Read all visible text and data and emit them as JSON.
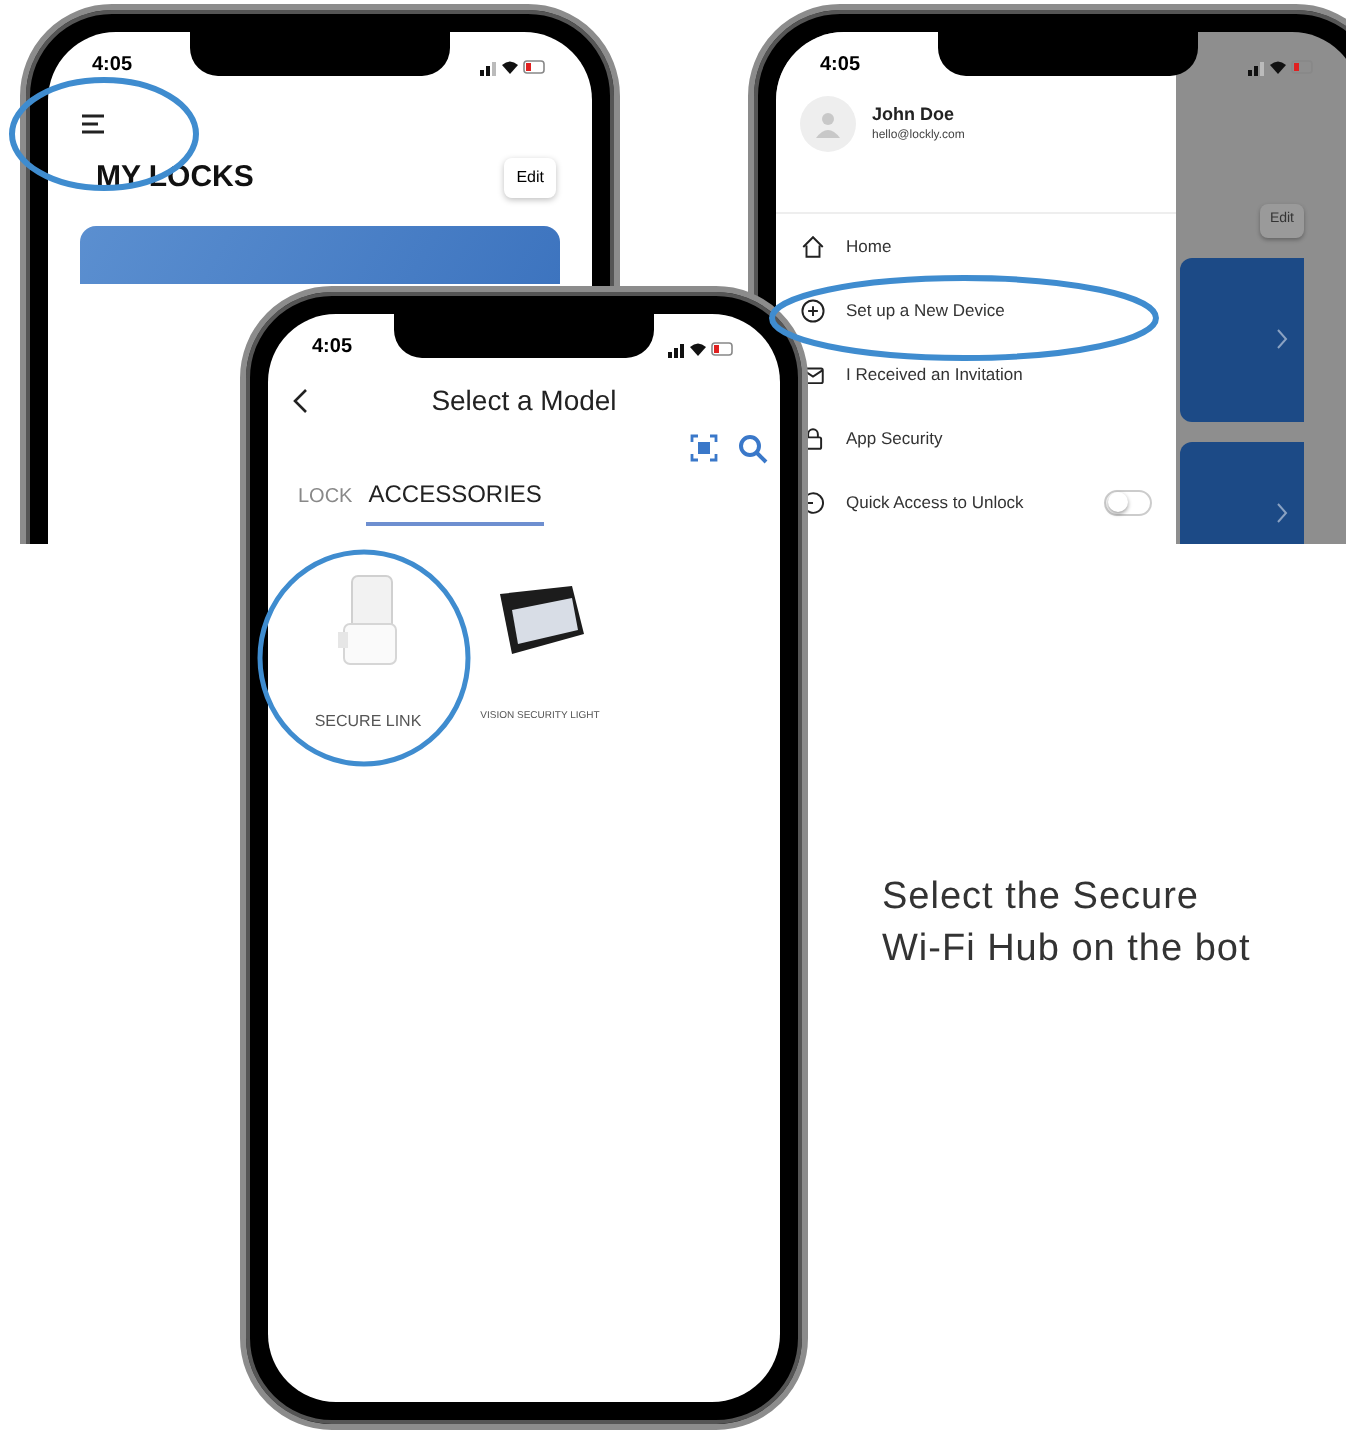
{
  "locks_screen": {
    "time": "4:05",
    "title": "MY LOCKS",
    "edit": "Edit"
  },
  "menu_screen": {
    "time": "4:05",
    "user_name": "John Doe",
    "email": "hello@lockly.com",
    "edit": "Edit",
    "items": [
      {
        "kind": "home",
        "label": "Home"
      },
      {
        "kind": "add",
        "label": "Set up a New Device"
      },
      {
        "kind": "invite",
        "label": "I Received an Invitation"
      },
      {
        "kind": "lock",
        "label": "App Security"
      },
      {
        "kind": "toggle",
        "label": "Quick Access to Unlock",
        "on": false
      }
    ]
  },
  "model_screen": {
    "time": "4:05",
    "title": "Select a Model",
    "tabs": [
      {
        "label": "LOCK",
        "selected": false
      },
      {
        "label": "ACCESSORIES",
        "selected": true
      }
    ],
    "products": [
      {
        "kind": "hub",
        "name": "SECURE LINK"
      },
      {
        "kind": "light",
        "name": "VISION SECURITY LIGHT"
      }
    ]
  },
  "caption": {
    "lines": [
      "Select the Secure",
      "Wi-Fi Hub on the bot"
    ]
  }
}
